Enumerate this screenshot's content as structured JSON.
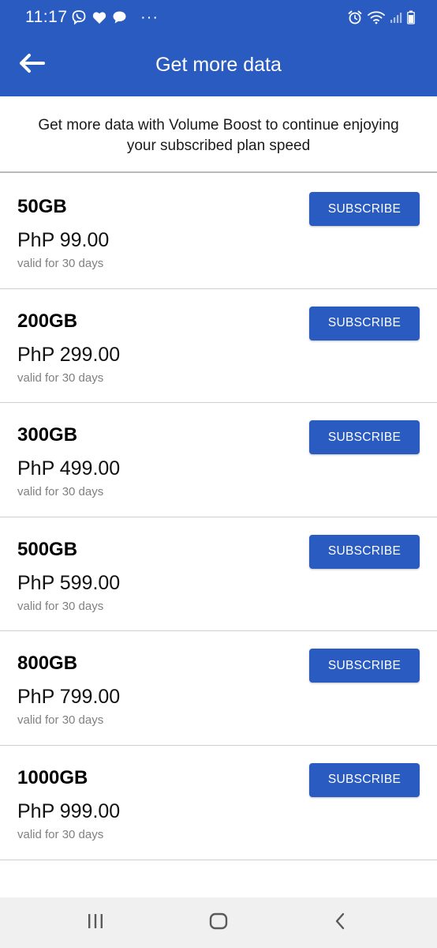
{
  "status_bar": {
    "time": "11:17",
    "left_icons": [
      "viber-icon",
      "heart-icon",
      "chat-bubble-icon"
    ],
    "more": "···",
    "right_icons": [
      "alarm-icon",
      "wifi-icon",
      "signal-icon",
      "battery-icon"
    ]
  },
  "app_bar": {
    "title": "Get more data",
    "back_icon": "arrow-left-icon"
  },
  "intro": {
    "text": "Get more data with Volume Boost to continue enjoying your subscribed plan speed"
  },
  "plans": [
    {
      "size": "50GB",
      "price": "PhP 99.00",
      "validity": "valid for 30 days",
      "button": "SUBSCRIBE"
    },
    {
      "size": "200GB",
      "price": "PhP 299.00",
      "validity": "valid for 30 days",
      "button": "SUBSCRIBE"
    },
    {
      "size": "300GB",
      "price": "PhP 499.00",
      "validity": "valid for 30 days",
      "button": "SUBSCRIBE"
    },
    {
      "size": "500GB",
      "price": "PhP 599.00",
      "validity": "valid for 30 days",
      "button": "SUBSCRIBE"
    },
    {
      "size": "800GB",
      "price": "PhP 799.00",
      "validity": "valid for 30 days",
      "button": "SUBSCRIBE"
    },
    {
      "size": "1000GB",
      "price": "PhP 999.00",
      "validity": "valid for 30 days",
      "button": "SUBSCRIBE"
    }
  ],
  "nav_bar": {
    "icons": [
      "recent-apps-icon",
      "home-icon",
      "back-icon"
    ]
  },
  "colors": {
    "primary": "#2a5bc0",
    "divider": "#cfcfcf",
    "muted_text": "#808080",
    "nav_background": "#f0f0f0"
  }
}
